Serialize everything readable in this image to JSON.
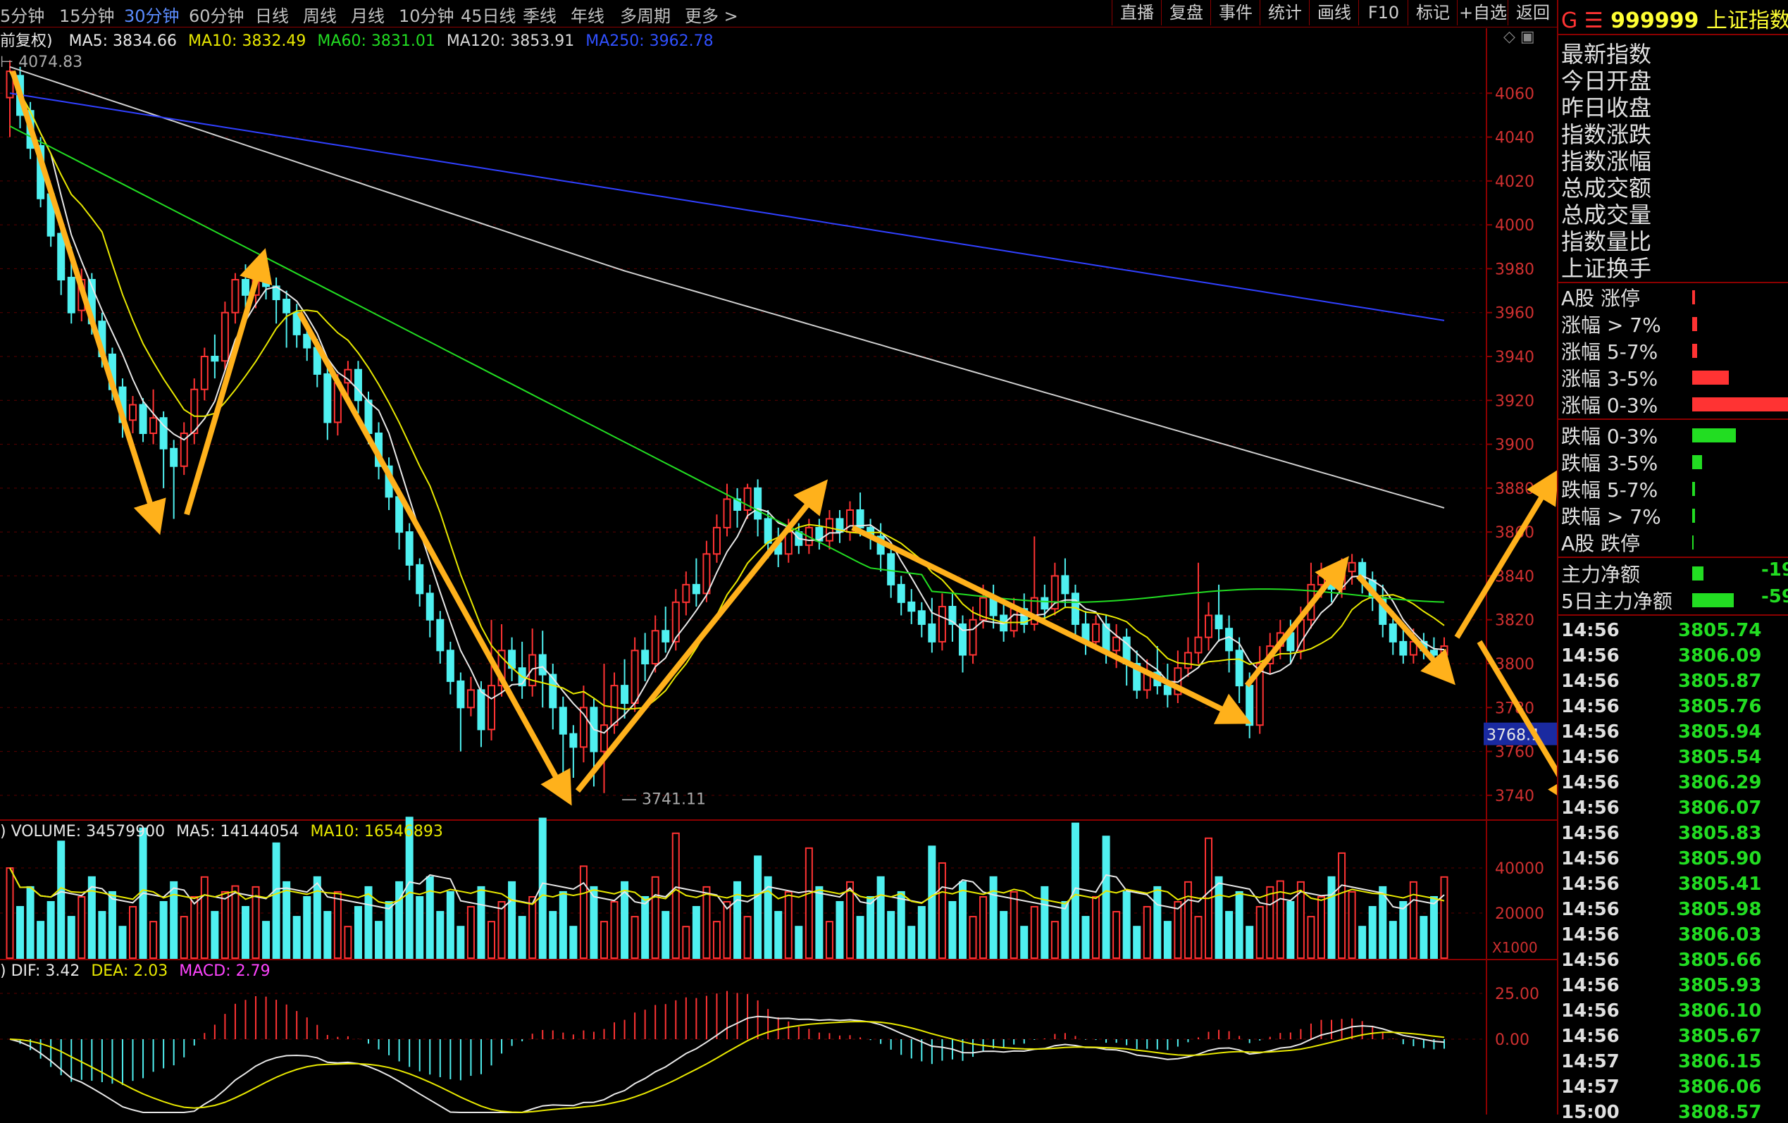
{
  "toolbar": {
    "timeframes": [
      {
        "label": "5分钟",
        "active": false
      },
      {
        "label": "15分钟",
        "active": false
      },
      {
        "label": "30分钟",
        "active": true
      },
      {
        "label": "60分钟",
        "active": false
      },
      {
        "label": "日线",
        "active": false
      },
      {
        "label": "周线",
        "active": false
      },
      {
        "label": "月线",
        "active": false
      },
      {
        "label": "10分钟",
        "active": false
      },
      {
        "label": "45日线",
        "active": false
      },
      {
        "label": "季线",
        "active": false
      },
      {
        "label": "年线",
        "active": false
      },
      {
        "label": "多周期",
        "active": false
      },
      {
        "label": "更多 >",
        "active": false
      }
    ],
    "buttons": [
      "直播",
      "复盘",
      "事件",
      "统计",
      "画线",
      "F10",
      "标记",
      "+自选",
      "返回"
    ]
  },
  "main_chart": {
    "adjust_label": "前复权)",
    "ma_labels": [
      {
        "text": "MA5: 3834.66",
        "color": "#e8e8e8"
      },
      {
        "text": "MA10: 3832.49",
        "color": "#e8e800"
      },
      {
        "text": "MA60: 3831.01",
        "color": "#22dd22"
      },
      {
        "text": "MA120: 3853.91",
        "color": "#d8d8d8"
      },
      {
        "text": "MA250: 3962.78",
        "color": "#3050ff"
      }
    ],
    "high_label": "4074.83",
    "low_label": "3741.11",
    "current_price_tag": "3768.1",
    "y_ticks": [
      "4060",
      "4040",
      "4020",
      "4000",
      "3980",
      "3960",
      "3940",
      "3920",
      "3900",
      "3880",
      "3860",
      "3840",
      "3820",
      "3800",
      "3780",
      "3760",
      "3740"
    ]
  },
  "volume_panel": {
    "labels": [
      {
        "text": ") VOLUME: 34579900",
        "color": "#e8e8e8"
      },
      {
        "text": "MA5: 14144054",
        "color": "#e8e8e8"
      },
      {
        "text": "MA10: 16546893",
        "color": "#e8e800"
      }
    ],
    "y_ticks": [
      "40000",
      "20000"
    ],
    "unit": "X1000"
  },
  "macd_panel": {
    "labels": [
      {
        "text": ") DIF: 3.42",
        "color": "#e8e8e8"
      },
      {
        "text": "DEA: 2.03",
        "color": "#e8e800"
      },
      {
        "text": "MACD: 2.79",
        "color": "#ff44ff"
      }
    ],
    "y_ticks": [
      "25.00",
      "0.00"
    ]
  },
  "right_panel": {
    "header_prefix": "G ☰",
    "code": "999999",
    "name": "上证指数",
    "fields": [
      "最新指数",
      "今日开盘",
      "昨日收盘",
      "指数涨跌",
      "指数涨幅",
      "总成交额",
      "总成交量",
      "指数量比",
      "上证换手"
    ],
    "up_stats": [
      {
        "label": "A股 涨停",
        "fraction": 0.03
      },
      {
        "label": "涨幅 > 7%",
        "fraction": 0.05
      },
      {
        "label": "涨幅 5-7%",
        "fraction": 0.05
      },
      {
        "label": "涨幅 3-5%",
        "fraction": 0.38
      },
      {
        "label": "涨幅 0-3%",
        "fraction": 1.0
      }
    ],
    "down_stats": [
      {
        "label": "跌幅 0-3%",
        "fraction": 0.45
      },
      {
        "label": "跌幅 3-5%",
        "fraction": 0.1
      },
      {
        "label": "跌幅 5-7%",
        "fraction": 0.03
      },
      {
        "label": "跌幅 > 7%",
        "fraction": 0.03
      },
      {
        "label": "A股 跌停",
        "fraction": 0.01
      }
    ],
    "capital_flow": [
      {
        "label": "主力净额",
        "value": "-19",
        "fraction": 0.12
      },
      {
        "label": "5日主力净额",
        "value": "-59",
        "fraction": 0.45
      }
    ],
    "ticks": [
      {
        "time": "14:56",
        "price": "3805.74"
      },
      {
        "time": "14:56",
        "price": "3806.09"
      },
      {
        "time": "14:56",
        "price": "3805.87"
      },
      {
        "time": "14:56",
        "price": "3805.76"
      },
      {
        "time": "14:56",
        "price": "3805.94"
      },
      {
        "time": "14:56",
        "price": "3805.54"
      },
      {
        "time": "14:56",
        "price": "3806.29"
      },
      {
        "time": "14:56",
        "price": "3806.07"
      },
      {
        "time": "14:56",
        "price": "3805.83"
      },
      {
        "time": "14:56",
        "price": "3805.90"
      },
      {
        "time": "14:56",
        "price": "3805.41"
      },
      {
        "time": "14:56",
        "price": "3805.98"
      },
      {
        "time": "14:56",
        "price": "3806.03"
      },
      {
        "time": "14:56",
        "price": "3805.66"
      },
      {
        "time": "14:56",
        "price": "3805.93"
      },
      {
        "time": "14:56",
        "price": "3806.10"
      },
      {
        "time": "14:56",
        "price": "3805.67"
      },
      {
        "time": "14:57",
        "price": "3806.15"
      },
      {
        "time": "14:57",
        "price": "3806.06"
      },
      {
        "time": "15:00",
        "price": "3808.57"
      }
    ]
  },
  "chart_data": {
    "type": "candlestick",
    "title": "上证指数 30分钟",
    "ylim": [
      3730,
      4080
    ],
    "candles": [
      [
        4058,
        4070,
        4040,
        4075
      ],
      [
        4068,
        4050,
        4044,
        4072
      ],
      [
        4052,
        4035,
        4030,
        4056
      ],
      [
        4036,
        4012,
        4008,
        4040
      ],
      [
        4014,
        3995,
        3990,
        4018
      ],
      [
        3996,
        3975,
        3968,
        3999
      ],
      [
        3976,
        3960,
        3955,
        3990
      ],
      [
        3961,
        3975,
        3956,
        3980
      ],
      [
        3975,
        3955,
        3950,
        3978
      ],
      [
        3956,
        3940,
        3935,
        3960
      ],
      [
        3941,
        3925,
        3920,
        3944
      ],
      [
        3926,
        3910,
        3903,
        3930
      ],
      [
        3911,
        3918,
        3905,
        3922
      ],
      [
        3918,
        3905,
        3901,
        3921
      ],
      [
        3905,
        3912,
        3900,
        3925
      ],
      [
        3912,
        3898,
        3880,
        3915
      ],
      [
        3898,
        3890,
        3866,
        3902
      ],
      [
        3890,
        3905,
        3886,
        3910
      ],
      [
        3905,
        3925,
        3900,
        3930
      ],
      [
        3925,
        3940,
        3920,
        3944
      ],
      [
        3940,
        3938,
        3930,
        3950
      ],
      [
        3938,
        3960,
        3934,
        3965
      ],
      [
        3960,
        3975,
        3955,
        3978
      ],
      [
        3975,
        3968,
        3962,
        3982
      ],
      [
        3968,
        3978,
        3962,
        3982
      ],
      [
        3978,
        3972,
        3966,
        3982
      ],
      [
        3972,
        3966,
        3955,
        3976
      ],
      [
        3966,
        3960,
        3944,
        3970
      ],
      [
        3960,
        3950,
        3944,
        3964
      ],
      [
        3950,
        3944,
        3938,
        3956
      ],
      [
        3944,
        3932,
        3926,
        3948
      ],
      [
        3932,
        3910,
        3902,
        3936
      ],
      [
        3910,
        3928,
        3904,
        3932
      ],
      [
        3928,
        3934,
        3922,
        3938
      ],
      [
        3934,
        3920,
        3914,
        3938
      ],
      [
        3920,
        3905,
        3900,
        3924
      ],
      [
        3905,
        3890,
        3884,
        3910
      ],
      [
        3890,
        3876,
        3870,
        3894
      ],
      [
        3876,
        3860,
        3852,
        3880
      ],
      [
        3860,
        3845,
        3838,
        3864
      ],
      [
        3845,
        3832,
        3826,
        3848
      ],
      [
        3832,
        3820,
        3812,
        3836
      ],
      [
        3820,
        3806,
        3800,
        3824
      ],
      [
        3806,
        3792,
        3786,
        3810
      ],
      [
        3792,
        3780,
        3760,
        3796
      ],
      [
        3780,
        3788,
        3776,
        3794
      ],
      [
        3788,
        3770,
        3762,
        3792
      ],
      [
        3770,
        3790,
        3765,
        3820
      ],
      [
        3790,
        3806,
        3785,
        3818
      ],
      [
        3806,
        3798,
        3792,
        3812
      ],
      [
        3798,
        3790,
        3784,
        3810
      ],
      [
        3790,
        3804,
        3785,
        3816
      ],
      [
        3804,
        3795,
        3780,
        3815
      ],
      [
        3795,
        3780,
        3770,
        3800
      ],
      [
        3780,
        3768,
        3750,
        3785
      ],
      [
        3768,
        3762,
        3748,
        3772
      ],
      [
        3762,
        3780,
        3755,
        3790
      ],
      [
        3780,
        3760,
        3744,
        3784
      ],
      [
        3760,
        3772,
        3741,
        3800
      ],
      [
        3772,
        3790,
        3768,
        3796
      ],
      [
        3790,
        3782,
        3775,
        3802
      ],
      [
        3782,
        3806,
        3778,
        3812
      ],
      [
        3806,
        3800,
        3792,
        3814
      ],
      [
        3800,
        3815,
        3796,
        3822
      ],
      [
        3815,
        3810,
        3805,
        3826
      ],
      [
        3810,
        3828,
        3806,
        3834
      ],
      [
        3828,
        3836,
        3822,
        3842
      ],
      [
        3836,
        3832,
        3826,
        3848
      ],
      [
        3832,
        3850,
        3828,
        3856
      ],
      [
        3850,
        3862,
        3846,
        3868
      ],
      [
        3862,
        3875,
        3858,
        3882
      ],
      [
        3875,
        3870,
        3862,
        3880
      ],
      [
        3870,
        3880,
        3866,
        3882
      ],
      [
        3880,
        3866,
        3858,
        3884
      ],
      [
        3866,
        3855,
        3848,
        3870
      ],
      [
        3855,
        3850,
        3844,
        3862
      ],
      [
        3850,
        3860,
        3846,
        3866
      ],
      [
        3860,
        3854,
        3850,
        3864
      ],
      [
        3854,
        3862,
        3850,
        3866
      ],
      [
        3862,
        3856,
        3852,
        3866
      ],
      [
        3856,
        3866,
        3852,
        3870
      ],
      [
        3866,
        3860,
        3855,
        3870
      ],
      [
        3860,
        3870,
        3856,
        3874
      ],
      [
        3870,
        3862,
        3858,
        3878
      ],
      [
        3862,
        3858,
        3852,
        3866
      ],
      [
        3858,
        3850,
        3842,
        3864
      ],
      [
        3850,
        3836,
        3830,
        3854
      ],
      [
        3836,
        3828,
        3822,
        3840
      ],
      [
        3828,
        3824,
        3818,
        3834
      ],
      [
        3824,
        3818,
        3812,
        3828
      ],
      [
        3818,
        3810,
        3805,
        3830
      ],
      [
        3810,
        3826,
        3806,
        3832
      ],
      [
        3826,
        3818,
        3810,
        3832
      ],
      [
        3818,
        3804,
        3796,
        3822
      ],
      [
        3804,
        3820,
        3800,
        3826
      ],
      [
        3820,
        3830,
        3816,
        3836
      ],
      [
        3830,
        3822,
        3816,
        3836
      ],
      [
        3822,
        3815,
        3810,
        3828
      ],
      [
        3815,
        3825,
        3812,
        3830
      ],
      [
        3825,
        3818,
        3814,
        3832
      ],
      [
        3818,
        3830,
        3815,
        3858
      ],
      [
        3830,
        3825,
        3820,
        3836
      ],
      [
        3825,
        3840,
        3822,
        3846
      ],
      [
        3840,
        3832,
        3826,
        3848
      ],
      [
        3832,
        3818,
        3812,
        3836
      ],
      [
        3818,
        3810,
        3804,
        3824
      ],
      [
        3810,
        3818,
        3806,
        3822
      ],
      [
        3818,
        3806,
        3800,
        3822
      ],
      [
        3806,
        3812,
        3798,
        3818
      ],
      [
        3812,
        3800,
        3790,
        3816
      ],
      [
        3800,
        3788,
        3784,
        3806
      ],
      [
        3788,
        3796,
        3784,
        3802
      ],
      [
        3796,
        3790,
        3786,
        3808
      ],
      [
        3790,
        3786,
        3780,
        3800
      ],
      [
        3786,
        3798,
        3782,
        3806
      ],
      [
        3798,
        3805,
        3794,
        3812
      ],
      [
        3805,
        3812,
        3800,
        3846
      ],
      [
        3812,
        3822,
        3806,
        3828
      ],
      [
        3822,
        3816,
        3810,
        3836
      ],
      [
        3816,
        3806,
        3796,
        3822
      ],
      [
        3806,
        3790,
        3782,
        3812
      ],
      [
        3790,
        3772,
        3766,
        3796
      ],
      [
        3772,
        3800,
        3768,
        3808
      ],
      [
        3800,
        3808,
        3795,
        3814
      ],
      [
        3808,
        3814,
        3802,
        3820
      ],
      [
        3814,
        3806,
        3800,
        3820
      ],
      [
        3806,
        3820,
        3802,
        3826
      ],
      [
        3820,
        3836,
        3816,
        3846
      ],
      [
        3836,
        3840,
        3830,
        3846
      ],
      [
        3840,
        3834,
        3828,
        3844
      ],
      [
        3834,
        3842,
        3830,
        3848
      ],
      [
        3842,
        3846,
        3836,
        3850
      ],
      [
        3846,
        3838,
        3832,
        3848
      ],
      [
        3838,
        3830,
        3824,
        3842
      ],
      [
        3830,
        3818,
        3812,
        3836
      ],
      [
        3818,
        3810,
        3804,
        3824
      ],
      [
        3810,
        3804,
        3800,
        3816
      ],
      [
        3804,
        3810,
        3800,
        3816
      ],
      [
        3810,
        3806,
        3802,
        3814
      ],
      [
        3806,
        3804,
        3800,
        3812
      ],
      [
        3804,
        3808,
        3802,
        3812
      ]
    ]
  }
}
